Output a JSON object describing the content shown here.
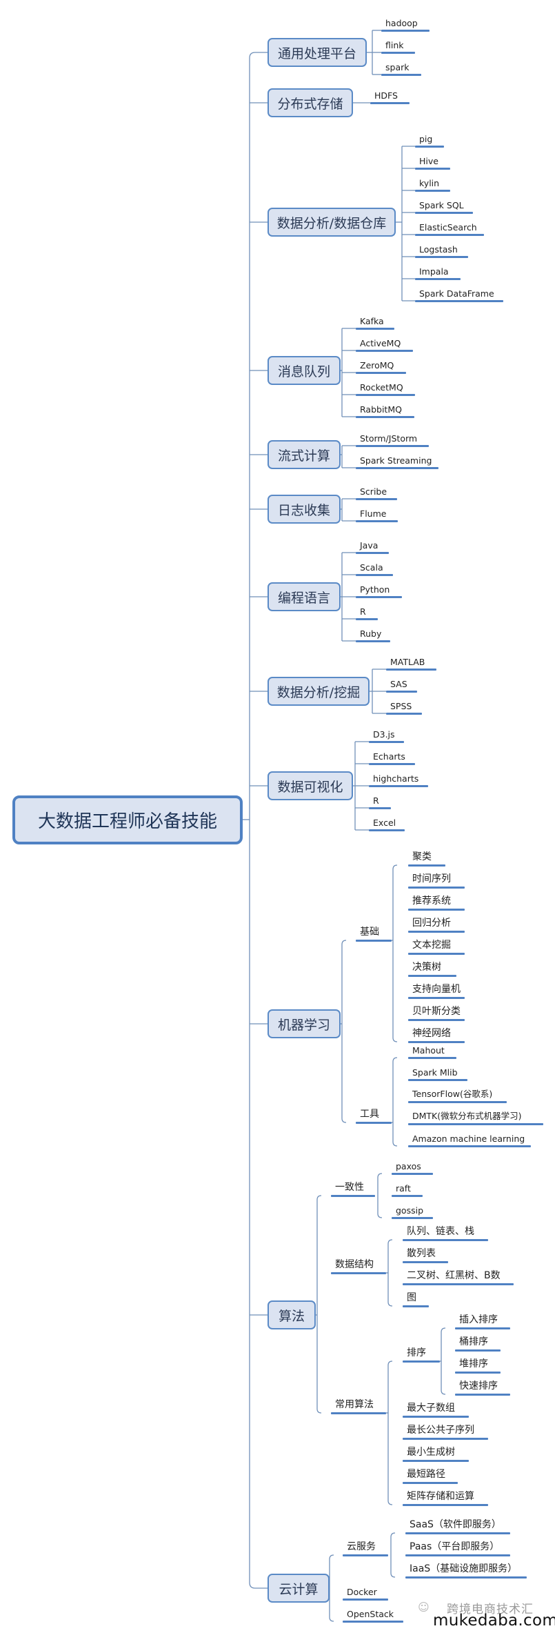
{
  "root": {
    "label": "大数据工程师必备技能",
    "children": [
      {
        "label": "通用处理平台",
        "children": [
          {
            "label": "hadoop"
          },
          {
            "label": "flink"
          },
          {
            "label": "spark"
          }
        ]
      },
      {
        "label": "分布式存储",
        "children": [
          {
            "label": "HDFS"
          }
        ]
      },
      {
        "label": "数据分析/数据仓库",
        "children": [
          {
            "label": "pig"
          },
          {
            "label": "Hive"
          },
          {
            "label": "kylin"
          },
          {
            "label": "Spark SQL"
          },
          {
            "label": "ElasticSearch"
          },
          {
            "label": "Logstash"
          },
          {
            "label": "Impala"
          },
          {
            "label": "Spark DataFrame"
          }
        ]
      },
      {
        "label": "消息队列",
        "children": [
          {
            "label": "Kafka"
          },
          {
            "label": "ActiveMQ"
          },
          {
            "label": "ZeroMQ"
          },
          {
            "label": "RocketMQ"
          },
          {
            "label": "RabbitMQ"
          }
        ]
      },
      {
        "label": "流式计算",
        "children": [
          {
            "label": "Storm/JStorm"
          },
          {
            "label": "Spark Streaming"
          }
        ]
      },
      {
        "label": "日志收集",
        "children": [
          {
            "label": "Scribe"
          },
          {
            "label": "Flume"
          }
        ]
      },
      {
        "label": "编程语言",
        "children": [
          {
            "label": "Java"
          },
          {
            "label": "Scala"
          },
          {
            "label": "Python"
          },
          {
            "label": "R"
          },
          {
            "label": "Ruby"
          }
        ]
      },
      {
        "label": "数据分析/挖掘",
        "children": [
          {
            "label": "MATLAB"
          },
          {
            "label": "SAS"
          },
          {
            "label": "SPSS"
          }
        ]
      },
      {
        "label": "数据可视化",
        "children": [
          {
            "label": "D3.js"
          },
          {
            "label": "Echarts"
          },
          {
            "label": "highcharts"
          },
          {
            "label": "R"
          },
          {
            "label": "Excel"
          }
        ]
      },
      {
        "label": "机器学习",
        "children": [
          {
            "label": "基础",
            "children": [
              {
                "label": "聚类"
              },
              {
                "label": "时间序列"
              },
              {
                "label": "推荐系统"
              },
              {
                "label": "回归分析"
              },
              {
                "label": "文本挖掘"
              },
              {
                "label": "决策树"
              },
              {
                "label": "支持向量机"
              },
              {
                "label": "贝叶斯分类"
              },
              {
                "label": "神经网络"
              }
            ]
          },
          {
            "label": "工具",
            "children": [
              {
                "label": "Mahout"
              },
              {
                "label": "Spark Mlib"
              },
              {
                "label": "TensorFlow(谷歌系)"
              },
              {
                "label": "DMTK(微软分布式机器学习)"
              },
              {
                "label": "Amazon machine learning"
              }
            ]
          }
        ]
      },
      {
        "label": "算法",
        "children": [
          {
            "label": "一致性",
            "children": [
              {
                "label": "paxos"
              },
              {
                "label": "raft"
              },
              {
                "label": "gossip"
              }
            ]
          },
          {
            "label": "数据结构",
            "children": [
              {
                "label": "队列、链表、栈"
              },
              {
                "label": "散列表"
              },
              {
                "label": "二叉树、红黑树、B数"
              },
              {
                "label": "图"
              }
            ]
          },
          {
            "label": "常用算法",
            "children": [
              {
                "label": "排序",
                "children": [
                  {
                    "label": "插入排序"
                  },
                  {
                    "label": "桶排序"
                  },
                  {
                    "label": "堆排序"
                  },
                  {
                    "label": "快速排序"
                  }
                ]
              },
              {
                "label": "最大子数组"
              },
              {
                "label": "最长公共子序列"
              },
              {
                "label": "最小生成树"
              },
              {
                "label": "最短路径"
              },
              {
                "label": "矩阵存储和运算"
              }
            ]
          }
        ]
      },
      {
        "label": "云计算",
        "children": [
          {
            "label": "云服务",
            "children": [
              {
                "label": "SaaS（软件即服务）"
              },
              {
                "label": "Paas（平台即服务）"
              },
              {
                "label": "IaaS（基础设施即服务）"
              }
            ]
          },
          {
            "label": "Docker"
          },
          {
            "label": "OpenStack"
          }
        ]
      }
    ]
  },
  "watermark": {
    "icon": "wechat-icon",
    "name": "跨境电商技术汇",
    "url": "mukedaba.com"
  },
  "colors": {
    "node_fill": "#dbe3f1",
    "node_border": "#5a8ac6",
    "underline": "#4f81c3",
    "connector": "#6f8fb8"
  }
}
